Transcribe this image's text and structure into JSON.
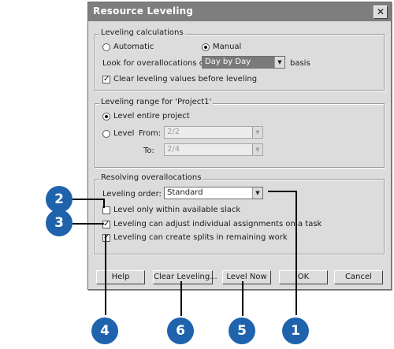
{
  "dialog": {
    "title": "Resource Leveling",
    "close_glyph": "✕"
  },
  "calc": {
    "legend": "Leveling calculations",
    "automatic": "Automatic",
    "manual": "Manual",
    "look_label": "Look for overallocations on a",
    "basis_value": "Day by Day",
    "basis_suffix": "basis",
    "clear_values": "Clear leveling values before leveling"
  },
  "range": {
    "legend": "Leveling range for 'Project1'",
    "entire": "Level entire project",
    "level": "Level",
    "from_label": "From:",
    "from_value": "2/2",
    "to_label": "To:",
    "to_value": "2/4"
  },
  "resolve": {
    "legend": "Resolving overallocations",
    "order_label": "Leveling order:",
    "order_value": "Standard",
    "slack": "Level only within available slack",
    "adjust": "Leveling can adjust individual assignments on a task",
    "splits": "Leveling can create splits in remaining work"
  },
  "buttons": {
    "help": "Help",
    "clear": "Clear Leveling...",
    "level_now": "Level Now",
    "ok": "OK",
    "cancel": "Cancel"
  },
  "callouts": {
    "c1": "1",
    "c2": "2",
    "c3": "3",
    "c4": "4",
    "c5": "5",
    "c6": "6"
  },
  "colors": {
    "callout_fill": "#1f63ad",
    "titlebar": "#7e7e7e"
  }
}
